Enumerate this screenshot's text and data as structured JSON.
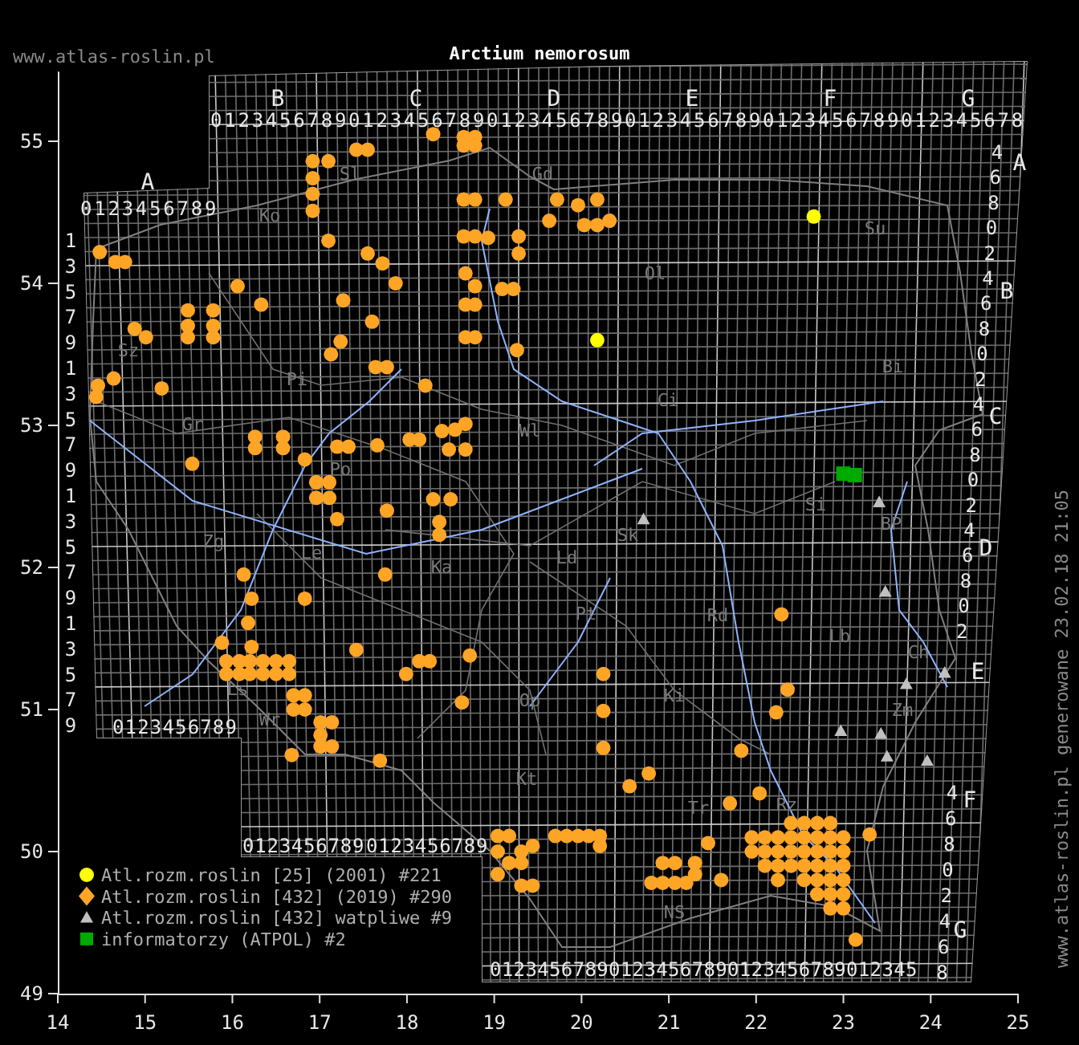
{
  "site_url": "www.atlas-roslin.pl",
  "title": "Arctium nemorosum",
  "generated_note": "www.atlas-roslin.pl generowane 23.02.18 21:05",
  "grid": {
    "column_letters": [
      "B",
      "C",
      "D",
      "E",
      "F",
      "G"
    ],
    "top_digit_rows": [
      "0123456789",
      "0123456789",
      "0123456789",
      "0123456789",
      "0123456789",
      "012345678"
    ],
    "left_block_letter": "A",
    "left_block_digits": "0123456789",
    "left_row_digits": [
      "1",
      "3",
      "5",
      "7",
      "9",
      "1",
      "3",
      "5",
      "7",
      "9",
      "1",
      "3",
      "5",
      "7",
      "9",
      "1",
      "3",
      "5",
      "7",
      "9"
    ],
    "lower_left_digit_rows": [
      "0123456789"
    ],
    "middle_digit_rows": [
      "0123456789",
      "0123456789"
    ],
    "bottom_digit_rows": [
      "0123456789",
      "0123456789",
      "0123456789",
      "012345"
    ],
    "right_row_letters": [
      "A",
      "B",
      "C",
      "D",
      "E",
      "F",
      "G"
    ],
    "right_row_digits": [
      "4",
      "6",
      "8",
      "0",
      "2",
      "4",
      "6",
      "8",
      "0",
      "2",
      "4",
      "6",
      "8",
      "0",
      "2",
      "4",
      "6",
      "8",
      "0",
      "2"
    ],
    "right_lower_row_digits": [
      "4",
      "6",
      "8",
      "0",
      "2",
      "4",
      "6",
      "8"
    ]
  },
  "region_labels": [
    "Ko",
    "Sl",
    "Gd",
    "Ol",
    "Su",
    "Sz",
    "Bi",
    "Pi",
    "Gr",
    "Ci",
    "Wl",
    "Po",
    "Zg",
    "Le",
    "Ka",
    "Ld",
    "Sk",
    "Si",
    "BP",
    "Pt",
    "Rd",
    "Lb",
    "Ch",
    "Zm",
    "Wr",
    "Ls",
    "Op",
    "Ki",
    "Kt",
    "Tr",
    "Rz",
    "NS"
  ],
  "chart_data": {
    "type": "scatter",
    "xlim": [
      14,
      25
    ],
    "ylim": [
      49,
      55.49
    ],
    "xticks": [
      14,
      15,
      16,
      17,
      18,
      19,
      20,
      21,
      22,
      23,
      24,
      25
    ],
    "yticks": [
      49,
      50,
      51,
      52,
      53,
      54,
      55
    ],
    "series": [
      {
        "name": "Atl.rozm.roslin [25] (2001) #221",
        "color": "#ffff00",
        "x": [
          20.18,
          22.66
        ],
        "values": [
          53.6,
          54.47
        ]
      },
      {
        "name": "Atl.rozm.roslin [432] (2019) #290",
        "color": "#ffa526",
        "x": [
          16.92,
          16.92,
          16.92,
          16.92,
          17.1,
          17.42,
          17.55,
          18.3,
          18.65,
          18.78,
          18.65,
          18.78,
          18.65,
          18.78,
          19.13,
          19.72,
          19.96,
          20.18,
          20.32,
          20.18,
          20.03,
          19.63,
          19.28,
          19.28,
          18.93,
          18.65,
          18.78,
          14.48,
          14.66,
          14.77,
          17.1,
          17.55,
          17.72,
          17.87,
          17.27,
          17.6,
          17.24,
          18.67,
          18.78,
          18.67,
          18.78,
          18.67,
          18.78,
          19.09,
          19.22,
          19.26,
          16.06,
          15.49,
          15.49,
          15.49,
          15.78,
          15.78,
          15.78,
          16.33,
          14.88,
          15.01,
          14.46,
          14.44,
          14.64,
          15.19,
          16.26,
          16.26,
          16.58,
          16.58,
          16.83,
          17.2,
          17.33,
          17.66,
          16.96,
          17.11,
          16.96,
          17.11,
          17.2,
          17.77,
          18.3,
          18.5,
          18.37,
          18.37,
          18.03,
          18.14,
          18.4,
          18.55,
          18.67,
          18.67,
          18.48,
          17.64,
          17.77,
          18.21,
          17.13,
          15.54,
          16.13,
          16.22,
          16.83,
          16.18,
          17.75,
          15.88,
          15.93,
          16.08,
          16.2,
          16.35,
          16.5,
          16.65,
          15.93,
          16.08,
          16.2,
          16.35,
          16.5,
          16.65,
          16.22,
          16.7,
          16.83,
          16.7,
          16.83,
          17.01,
          17.14,
          17.01,
          17.01,
          17.14,
          17.42,
          16.68,
          17.69,
          18.14,
          18.26,
          17.99,
          18.63,
          18.72,
          20.25,
          20.25,
          20.25,
          20.55,
          20.77,
          21.83,
          22.23,
          22.36,
          22.29,
          21.7,
          19.04,
          19.17,
          19.31,
          19.04,
          19.17,
          19.04,
          19.31,
          19.44,
          19.7,
          19.83,
          19.96,
          20.08,
          20.21,
          20.21,
          19.31,
          19.44,
          20.8,
          20.93,
          21.07,
          21.2,
          21.3,
          21.3,
          21.07,
          20.93,
          21.45,
          21.6,
          21.95,
          22.1,
          22.25,
          22.4,
          22.55,
          22.7,
          22.85,
          21.95,
          22.1,
          22.25,
          22.4,
          22.55,
          22.7,
          22.85,
          23.0,
          22.1,
          22.25,
          22.4,
          22.55,
          22.7,
          22.85,
          23.0,
          22.25,
          22.4,
          22.55,
          22.7,
          22.85,
          23.0,
          22.55,
          22.7,
          22.85,
          23.0,
          22.7,
          22.85,
          23.0,
          22.85,
          23.0,
          23.14,
          23.3,
          22.04
        ],
        "values": [
          54.86,
          54.74,
          54.63,
          54.51,
          54.86,
          54.94,
          54.94,
          55.05,
          55.03,
          55.03,
          54.97,
          54.97,
          54.59,
          54.59,
          54.59,
          54.59,
          54.55,
          54.59,
          54.44,
          54.41,
          54.41,
          54.44,
          54.33,
          54.21,
          54.32,
          54.33,
          54.33,
          54.22,
          54.15,
          54.15,
          54.3,
          54.21,
          54.14,
          54.0,
          53.88,
          53.73,
          53.59,
          54.07,
          53.98,
          53.85,
          53.85,
          53.62,
          53.62,
          53.96,
          53.96,
          53.53,
          53.98,
          53.81,
          53.7,
          53.62,
          53.81,
          53.7,
          53.62,
          53.85,
          53.68,
          53.62,
          53.28,
          53.2,
          53.33,
          53.26,
          52.92,
          52.84,
          52.92,
          52.84,
          52.76,
          52.85,
          52.85,
          52.86,
          52.6,
          52.6,
          52.49,
          52.49,
          52.34,
          52.4,
          52.48,
          52.48,
          52.32,
          52.23,
          52.9,
          52.9,
          52.96,
          52.97,
          53.01,
          52.83,
          52.83,
          53.41,
          53.41,
          53.28,
          53.5,
          52.73,
          51.95,
          51.78,
          51.78,
          51.61,
          51.95,
          51.47,
          51.34,
          51.34,
          51.34,
          51.34,
          51.34,
          51.34,
          51.25,
          51.25,
          51.25,
          51.25,
          51.25,
          51.25,
          51.44,
          51.1,
          51.1,
          51.0,
          51.0,
          50.91,
          50.91,
          50.82,
          50.74,
          50.74,
          51.42,
          50.68,
          50.64,
          51.34,
          51.34,
          51.25,
          51.05,
          51.38,
          51.25,
          50.99,
          50.73,
          50.46,
          50.55,
          50.71,
          50.98,
          51.14,
          51.67,
          50.34,
          50.11,
          50.11,
          50.0,
          50.0,
          49.92,
          49.84,
          49.76,
          49.76,
          50.11,
          50.11,
          50.11,
          50.11,
          50.11,
          50.04,
          49.92,
          50.04,
          49.78,
          49.78,
          49.78,
          49.78,
          49.84,
          49.92,
          49.92,
          49.92,
          50.06,
          49.8,
          50.1,
          50.1,
          50.1,
          50.2,
          50.2,
          50.2,
          50.2,
          50.0,
          50.0,
          50.0,
          50.1,
          50.1,
          50.1,
          50.1,
          50.1,
          49.9,
          49.9,
          50.0,
          50.0,
          50.0,
          50.0,
          50.0,
          49.8,
          49.9,
          49.9,
          49.9,
          49.9,
          49.9,
          49.8,
          49.8,
          49.8,
          49.8,
          49.7,
          49.7,
          49.7,
          49.6,
          49.6,
          49.38,
          50.12,
          50.41
        ]
      },
      {
        "name": "Atl.rozm.roslin [432] watpliwe #9",
        "color": "#c0c0c0",
        "x": [
          20.71,
          23.41,
          23.48,
          23.72,
          24.16,
          22.97,
          23.43,
          23.5,
          23.96
        ],
        "values": [
          52.34,
          52.46,
          51.83,
          51.18,
          51.26,
          50.85,
          50.83,
          50.67,
          50.64
        ]
      },
      {
        "name": "informatorzy (ATPOL) #2",
        "color": "#00aa00",
        "x": [
          23.0,
          23.13
        ],
        "values": [
          52.66,
          52.65
        ]
      }
    ]
  }
}
